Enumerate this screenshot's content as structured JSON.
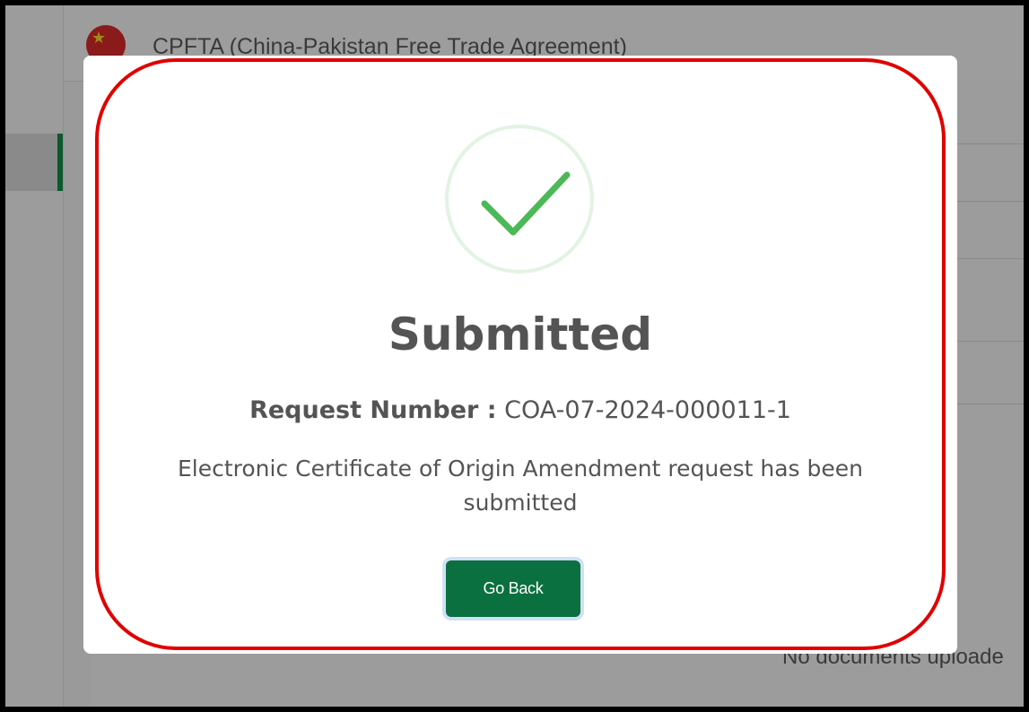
{
  "background": {
    "header_title": "CPFTA (China-Pakistan Free Trade Agreement)",
    "flag_icon": "china-flag-icon",
    "documents_empty_text": "No documents uploade"
  },
  "modal": {
    "status_icon": "success-check-icon",
    "title": "Submitted",
    "request_number_label": "Request Number :",
    "request_number_value": "COA-07-2024-000011-1",
    "message": "Electronic Certificate of Origin Amendment request has been submitted",
    "go_back_label": "Go Back"
  },
  "colors": {
    "accent": "#0b7040",
    "check": "#4cb857",
    "highlight_outline": "#e00000"
  }
}
